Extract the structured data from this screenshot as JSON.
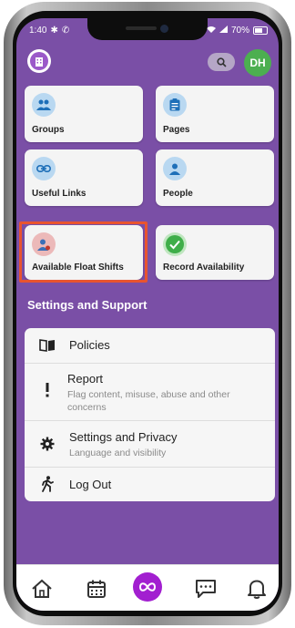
{
  "status_bar": {
    "time": "1:40",
    "battery": "70%"
  },
  "header": {
    "avatar_initials": "DH"
  },
  "tiles": [
    {
      "label": "Groups",
      "icon": "people-icon"
    },
    {
      "label": "Pages",
      "icon": "clipboard-icon"
    },
    {
      "label": "Useful Links",
      "icon": "link-icon"
    },
    {
      "label": "People",
      "icon": "person-icon"
    },
    {
      "label": "Available Float Shifts",
      "icon": "person-float-icon"
    },
    {
      "label": "Record Availability",
      "icon": "check-icon"
    }
  ],
  "settings": {
    "section_title": "Settings and Support",
    "items": [
      {
        "title": "Policies",
        "icon": "book-icon"
      },
      {
        "title": "Report",
        "subtitle": "Flag content, misuse, abuse and other concerns",
        "icon": "exclamation-icon"
      },
      {
        "title": "Settings and Privacy",
        "subtitle": "Language and visibility",
        "icon": "gear-icon"
      },
      {
        "title": "Log Out",
        "icon": "walking-person-icon"
      }
    ]
  },
  "tabbar": {
    "tabs": [
      "home-icon",
      "calendar-icon",
      "infinity-icon",
      "chat-icon",
      "bell-icon"
    ]
  },
  "colors": {
    "background": "#7a4fa6",
    "highlight": "#e8542f",
    "avatar": "#4caf50",
    "accent": "#a21fd0"
  }
}
